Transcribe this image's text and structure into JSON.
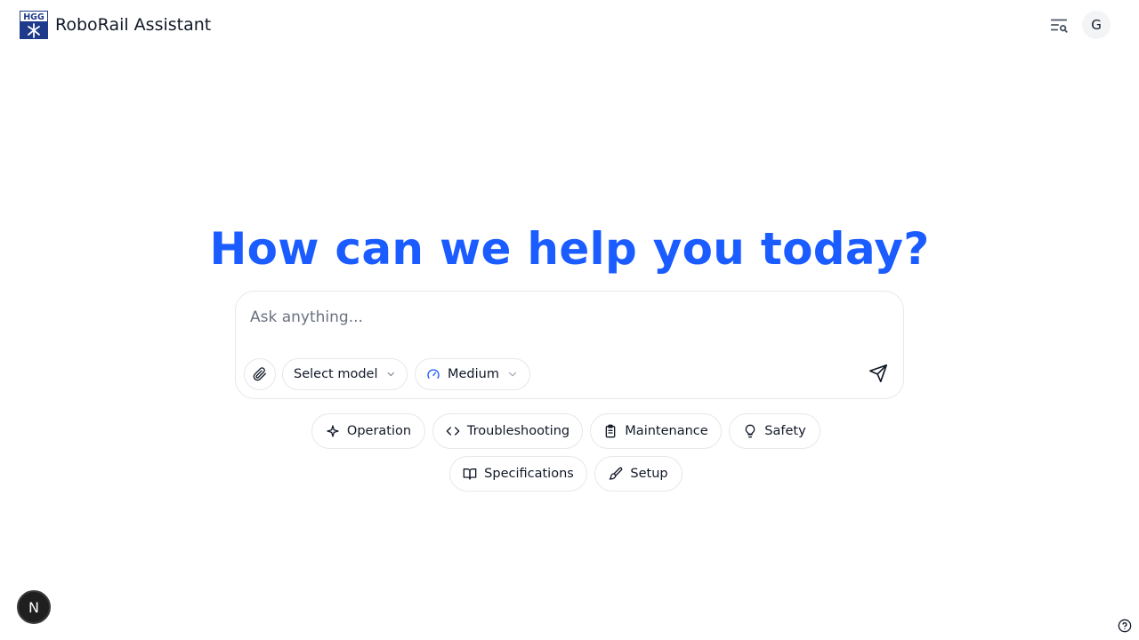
{
  "header": {
    "logo_text": "HGG",
    "app_title": "RoboRail Assistant",
    "history_icon": "list-search-icon",
    "avatar_initial": "G"
  },
  "main": {
    "headline": "How can we help you today?"
  },
  "composer": {
    "placeholder": "Ask anything...",
    "value": "",
    "attach_icon": "paperclip-icon",
    "model_select": {
      "label": "Select model",
      "icon": "chevron-down-icon"
    },
    "effort_select": {
      "label": "Medium",
      "icon": "gauge-icon"
    },
    "send_icon": "send-icon"
  },
  "suggestions": [
    {
      "label": "Operation",
      "icon": "sparkle-icon"
    },
    {
      "label": "Troubleshooting",
      "icon": "code-icon"
    },
    {
      "label": "Maintenance",
      "icon": "clipboard-icon"
    },
    {
      "label": "Safety",
      "icon": "lightbulb-icon"
    },
    {
      "label": "Specifications",
      "icon": "book-icon"
    },
    {
      "label": "Setup",
      "icon": "paintbrush-icon"
    }
  ],
  "footer": {
    "dev_badge": "N",
    "help_icon": "help-circle-icon"
  },
  "colors": {
    "accent": "#1a5cff",
    "border": "#e5e7eb",
    "logo_bg": "#1e3a8a"
  }
}
